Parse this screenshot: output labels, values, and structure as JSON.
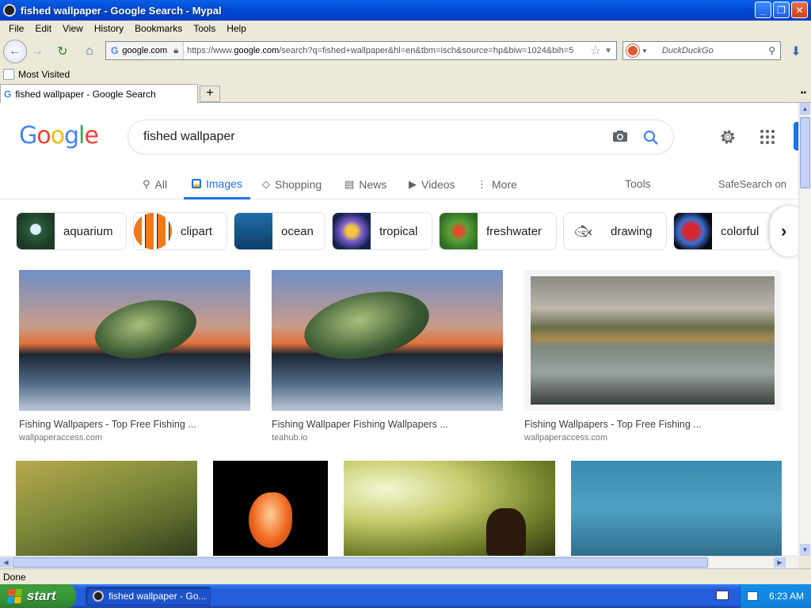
{
  "window": {
    "title": "fished wallpaper - Google Search - Mypal"
  },
  "menu": [
    "File",
    "Edit",
    "View",
    "History",
    "Bookmarks",
    "Tools",
    "Help"
  ],
  "navbar": {
    "site_identity": "google.com",
    "url_prefix": "https://www.",
    "url_domain": "google.com",
    "url_rest": "/search?q=fished+wallpaper&hl=en&tbm=isch&source=hp&biw=1024&bih=5",
    "search_placeholder": "DuckDuckGo"
  },
  "bookmarks": {
    "most_visited": "Most Visited"
  },
  "tabs": [
    {
      "label": "fished wallpaper - Google Search"
    }
  ],
  "google": {
    "query": "fished wallpaper",
    "tabs": [
      "All",
      "Images",
      "Shopping",
      "News",
      "Videos",
      "More"
    ],
    "active_tab": "Images",
    "tools_label": "Tools",
    "safesearch_label": "SafeSearch on"
  },
  "chips": [
    "aquarium",
    "clipart",
    "ocean",
    "tropical",
    "freshwater",
    "drawing",
    "colorful"
  ],
  "results": [
    {
      "title": "Fishing Wallpapers - Top Free Fishing ...",
      "source": "wallpaperaccess.com"
    },
    {
      "title": "Fishing Wallpaper Fishing Wallpapers ...",
      "source": "teahub.io"
    },
    {
      "title": "Fishing Wallpapers - Top Free Fishing ...",
      "source": "wallpaperaccess.com"
    }
  ],
  "status": {
    "text": "Done"
  },
  "taskbar": {
    "start_label": "start",
    "window_item": "fished wallpaper - Go...",
    "clock": "6:23 AM"
  },
  "colors": {
    "google_blue": "#4285F4",
    "google_red": "#EA4335",
    "google_yellow": "#FBBC05",
    "google_green": "#34A853",
    "active_tab": "#1a73e8",
    "xp_title": "#0a5fe6"
  }
}
